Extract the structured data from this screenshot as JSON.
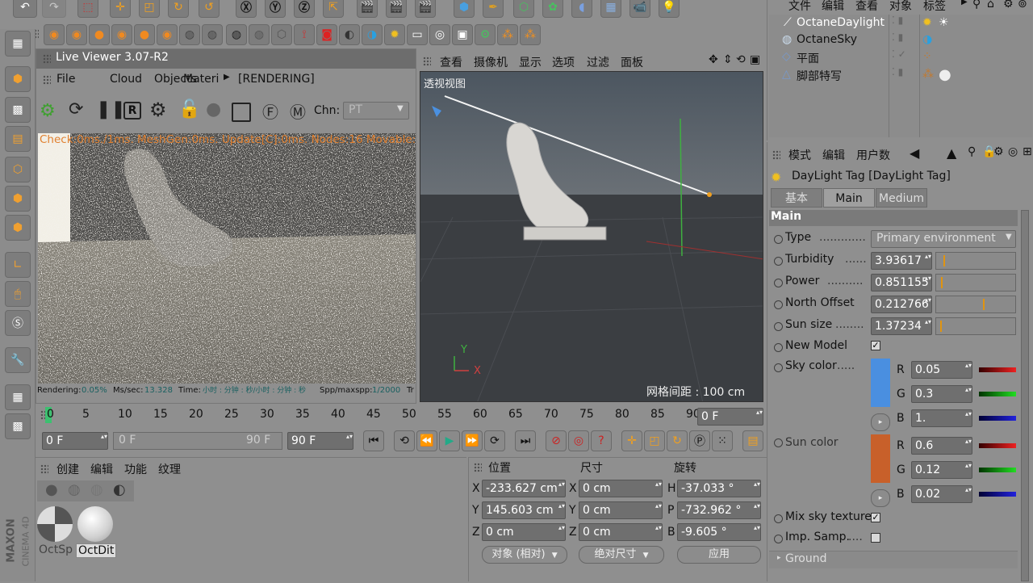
{
  "live_viewer": {
    "title": "Live Viewer 3.07-R2",
    "menu": [
      "File",
      "Cloud",
      "Objects",
      "Materi",
      "[RENDERING]"
    ],
    "chn_label": "Chn:",
    "chn_value": "PT",
    "overlay_text": "Check:0ms./1ms. MeshGen:0ms. Update[C]:0ms. Nodes:16 Movable:2",
    "status": {
      "rendering_label": "Rendering:",
      "rendering_value": "0.05%",
      "mssec_label": "Ms/sec:",
      "mssec_value": "13.328",
      "time_label": "Time:",
      "time_value": "小时 : 分钟 : 秒/小时 : 分钟 : 秒",
      "spp_label": "Spp/maxspp:",
      "spp_value": "1/2000",
      "tri_label": "Tr"
    }
  },
  "viewport": {
    "menu": [
      "查看",
      "摄像机",
      "显示",
      "选项",
      "过滤",
      "面板"
    ],
    "view_name": "透视视图",
    "grid_spacing": "网格间距 : 100 cm",
    "axis_y": "Y",
    "axis_x": "X"
  },
  "objects": {
    "menu": [
      "文件",
      "编辑",
      "查看",
      "对象",
      "标签"
    ],
    "items": [
      {
        "name": "OctaneDaylight"
      },
      {
        "name": "OctaneSky"
      },
      {
        "name": "平面"
      },
      {
        "name": "脚部特写"
      }
    ]
  },
  "attributes": {
    "menu": [
      "模式",
      "编辑",
      "用户数"
    ],
    "title": "DayLight Tag [DayLight Tag]",
    "tabs": [
      "基本",
      "Main",
      "Medium"
    ],
    "section": "Main",
    "type_label": "Type",
    "type_value": "Primary environment",
    "turbidity_label": "Turbidity",
    "turbidity_value": "3.93617",
    "turbidity_level": 0.07,
    "power_label": "Power",
    "power_value": "0.851155",
    "power_level": 0.04,
    "north_label": "North Offset",
    "north_value": "0.212766",
    "north_level": 0.58,
    "sunsize_label": "Sun size",
    "sunsize_value": "1.37234",
    "sunsize_level": 0.03,
    "newmodel_label": "New Model",
    "newmodel_checked": "✓",
    "skycolor_label": "Sky color",
    "skycolor_hex": "#4a8fe0",
    "sky_r_label": "R",
    "sky_r": "0.05",
    "sky_g_label": "G",
    "sky_g": "0.3",
    "sky_b_label": "B",
    "sky_b": "1.",
    "suncolor_label": "Sun color",
    "suncolor_hex": "#c8602a",
    "sun_r_label": "R",
    "sun_r": "0.6",
    "sun_g_label": "G",
    "sun_g": "0.12",
    "sun_b_label": "B",
    "sun_b": "0.02",
    "mixsky_label": "Mix sky texture",
    "mixsky_checked": "✓",
    "impsamp_label": "Imp. Samp.",
    "ground_label": "Ground"
  },
  "timeline": {
    "ticks": [
      "0",
      "5",
      "10",
      "15",
      "20",
      "25",
      "30",
      "35",
      "40",
      "45",
      "50",
      "55",
      "60",
      "65",
      "70",
      "75",
      "80",
      "85",
      "90"
    ],
    "current_frame": "0 F",
    "start_frame": "0 F",
    "range_start": "0 F",
    "range_end": "90 F",
    "end_frame": "90 F"
  },
  "materials": {
    "menu": [
      "创建",
      "编辑",
      "功能",
      "纹理"
    ],
    "items": [
      {
        "name": "OctSp"
      },
      {
        "name": "OctDit"
      }
    ]
  },
  "coords": {
    "headers": [
      "位置",
      "尺寸",
      "旋转"
    ],
    "rows": [
      {
        "pos_label": "X",
        "pos": "-233.627 cm",
        "size_label": "X",
        "size": "0 cm",
        "rot_label": "H",
        "rot": "-37.033 °"
      },
      {
        "pos_label": "Y",
        "pos": "145.603 cm",
        "size_label": "Y",
        "size": "0 cm",
        "rot_label": "P",
        "rot": "-732.962 °"
      },
      {
        "pos_label": "Z",
        "pos": "0 cm",
        "size_label": "Z",
        "size": "0 cm",
        "rot_label": "B",
        "rot": "-9.605 °"
      }
    ],
    "mode": "对象 (相对)",
    "size_mode": "绝对尺寸",
    "apply": "应用"
  },
  "brand": {
    "maxon": "MAXON",
    "c4d": "CINEMA 4D"
  },
  "colors": {
    "accent_orange": "#e09410",
    "sky_blue": "#4a8fe0",
    "sun_orange": "#c8602a"
  }
}
